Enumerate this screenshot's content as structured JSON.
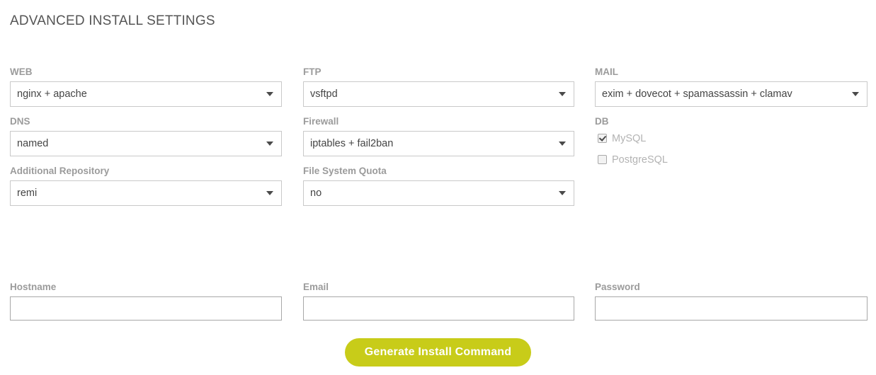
{
  "page": {
    "title": "ADVANCED INSTALL SETTINGS"
  },
  "columns": {
    "col1": [
      {
        "label": "WEB",
        "type": "select",
        "value": "nginx + apache"
      },
      {
        "label": "DNS",
        "type": "select",
        "value": "named"
      },
      {
        "label": "Additional Repository",
        "type": "select",
        "value": "remi"
      }
    ],
    "col2": [
      {
        "label": "FTP",
        "type": "select",
        "value": "vsftpd"
      },
      {
        "label": "Firewall",
        "type": "select",
        "value": "iptables + fail2ban"
      },
      {
        "label": "File System Quota",
        "type": "select",
        "value": "no"
      }
    ],
    "col3": [
      {
        "label": "MAIL",
        "type": "select",
        "value": "exim + dovecot + spamassassin + clamav"
      },
      {
        "label": "DB",
        "type": "checkbox-group",
        "options": [
          {
            "label": "MySQL",
            "checked": true
          },
          {
            "label": "PostgreSQL",
            "checked": false
          }
        ]
      }
    ]
  },
  "bottom": {
    "hostname": {
      "label": "Hostname",
      "value": "",
      "placeholder": ""
    },
    "email": {
      "label": "Email",
      "value": "",
      "placeholder": ""
    },
    "password": {
      "label": "Password",
      "value": "",
      "placeholder": ""
    }
  },
  "submit": {
    "label": "Generate Install Command"
  },
  "colors": {
    "accent": "#c8cc19",
    "label": "#9b9b9b",
    "title": "#555555",
    "field_border": "#c9c9c9",
    "input_border": "#a8a8a8",
    "value_text": "#444444",
    "checkbox_label": "#b3b3b3"
  },
  "icons": {
    "select_arrow": "chevron-down-icon",
    "checkbox_checked": "check-icon"
  }
}
